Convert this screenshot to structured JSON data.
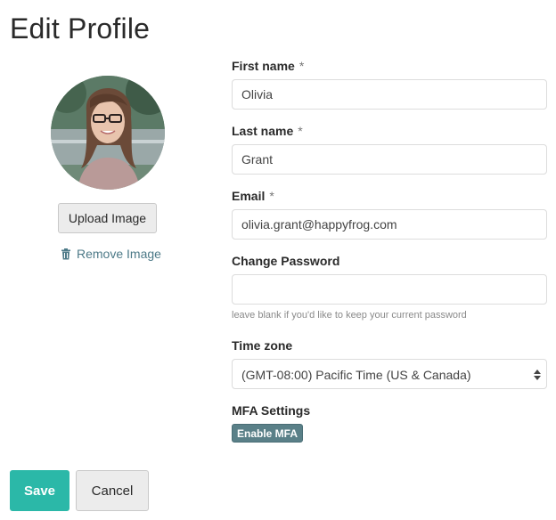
{
  "page": {
    "title": "Edit Profile"
  },
  "profile_image": {
    "upload_label": "Upload Image",
    "remove_label": "Remove Image"
  },
  "form": {
    "first_name": {
      "label": "First name",
      "required_mark": "*",
      "value": "Olivia"
    },
    "last_name": {
      "label": "Last name",
      "required_mark": "*",
      "value": "Grant"
    },
    "email": {
      "label": "Email",
      "required_mark": "*",
      "value": "olivia.grant@happyfrog.com"
    },
    "password": {
      "label": "Change Password",
      "value": "",
      "hint": "leave blank if you'd like to keep your current password"
    },
    "time_zone": {
      "label": "Time zone",
      "value": "(GMT-08:00) Pacific Time (US & Canada)"
    },
    "mfa": {
      "label": "MFA Settings",
      "button_label": "Enable MFA"
    }
  },
  "actions": {
    "save_label": "Save",
    "cancel_label": "Cancel"
  },
  "colors": {
    "primary": "#2bb8a8",
    "mfa_button": "#5a8088",
    "link": "#4d7a88"
  },
  "icons": {
    "remove": "trash-icon",
    "select": "select-arrows-icon"
  }
}
